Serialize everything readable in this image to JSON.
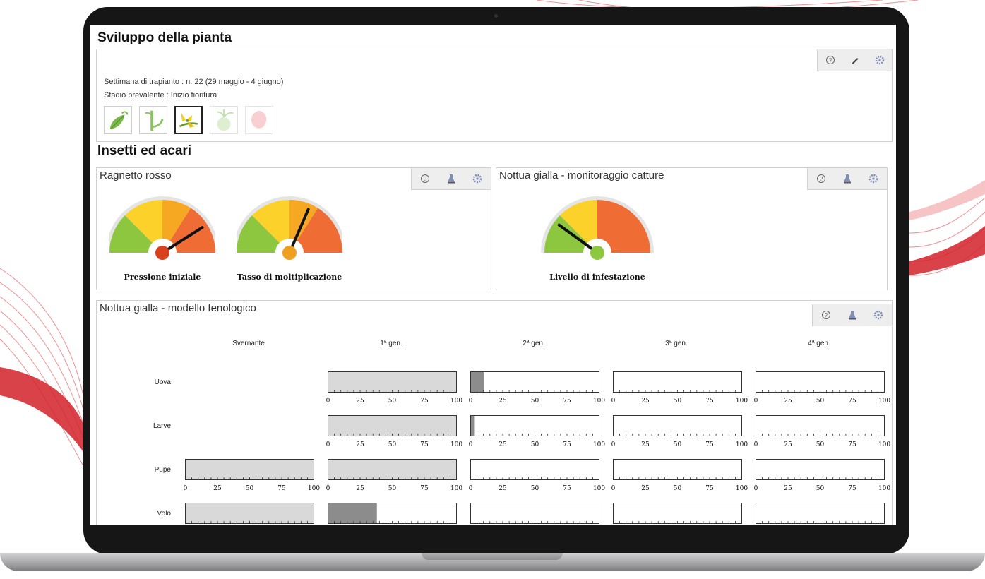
{
  "plant": {
    "title": "Sviluppo della pianta",
    "transplant_week": "Settimana di trapianto : n. 22 (29 maggio - 4 giugno)",
    "prevailing_stage": "Stadio prevalente : Inizio fioritura",
    "stages": [
      "foglie",
      "stelo",
      "fioritura",
      "allegagione",
      "frutto"
    ],
    "active_stage_index": 2,
    "toolbar_icons": [
      "help-icon",
      "edit-icon",
      "settings-icon"
    ]
  },
  "insects": {
    "title": "Insetti ed acari"
  },
  "ragnetto": {
    "title": "Ragnetto rosso",
    "toolbar_icons": [
      "help-icon",
      "flask-icon",
      "settings-icon"
    ],
    "gauges": [
      {
        "label": "Pressione iniziale",
        "value": 0.82,
        "hub_color": "#d9401e"
      },
      {
        "label": "Tasso di moltiplicazione",
        "value": 0.63,
        "hub_color": "#f0a020"
      }
    ]
  },
  "nottua_catture": {
    "title": "Nottua gialla - monitoraggio catture",
    "toolbar_icons": [
      "help-icon",
      "flask-icon",
      "settings-icon"
    ],
    "gauges": [
      {
        "label": "Livello di infestazione",
        "value": 0.2,
        "hub_color": "#8dc63f",
        "three_band": true
      }
    ]
  },
  "nottua_modello": {
    "title": "Nottua gialla - modello fenologico",
    "toolbar_icons": [
      "help-icon",
      "flask-icon",
      "settings-icon"
    ],
    "columns": [
      "Svernante",
      "1ª gen.",
      "2ª gen.",
      "3ª gen.",
      "4ª gen."
    ],
    "rows": [
      "Uova",
      "Larve",
      "Pupe",
      "Volo"
    ],
    "tick_labels": [
      "0",
      "25",
      "50",
      "75",
      "100"
    ],
    "bars": [
      [
        null,
        {
          "fill": 100,
          "color": "#d9d9d9"
        },
        {
          "fill": 10,
          "color": "#8c8c8c"
        },
        {
          "fill": 0,
          "color": "#d9d9d9"
        },
        {
          "fill": 0,
          "color": "#d9d9d9"
        }
      ],
      [
        null,
        {
          "fill": 100,
          "color": "#d9d9d9"
        },
        {
          "fill": 3,
          "color": "#8c8c8c"
        },
        {
          "fill": 0,
          "color": "#d9d9d9"
        },
        {
          "fill": 0,
          "color": "#d9d9d9"
        }
      ],
      [
        {
          "fill": 100,
          "color": "#d9d9d9"
        },
        {
          "fill": 100,
          "color": "#d9d9d9"
        },
        {
          "fill": 0,
          "color": "#d9d9d9"
        },
        {
          "fill": 0,
          "color": "#d9d9d9"
        },
        {
          "fill": 0,
          "color": "#d9d9d9"
        }
      ],
      [
        {
          "fill": 100,
          "color": "#d9d9d9"
        },
        {
          "fill": 38,
          "color": "#8c8c8c"
        },
        {
          "fill": 0,
          "color": "#d9d9d9"
        },
        {
          "fill": 0,
          "color": "#d9d9d9"
        },
        {
          "fill": 0,
          "color": "#d9d9d9"
        }
      ]
    ]
  },
  "colors": {
    "gauge_green": "#8dc63f",
    "gauge_yellow": "#fcd12a",
    "gauge_orange": "#f7a823",
    "gauge_red": "#ef6c35",
    "accent_red": "#e02a2a"
  }
}
